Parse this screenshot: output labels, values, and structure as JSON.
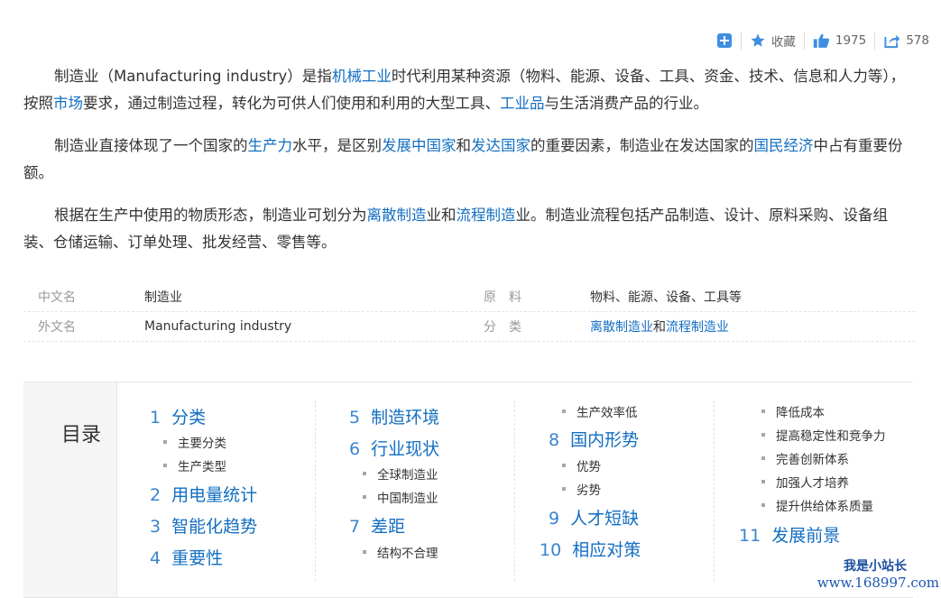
{
  "toolbar": {
    "collect_label": "收藏",
    "like_count": "1975",
    "share_count": "578"
  },
  "paragraphs": [
    [
      {
        "t": "制造业（Manufacturing industry）是指"
      },
      {
        "t": "机械工业",
        "link": true
      },
      {
        "t": "时代利用某种资源（物料、能源、设备、工具、资金、技术、信息和人力等），按照"
      },
      {
        "t": "市场",
        "link": true
      },
      {
        "t": "要求，通过制造过程，转化为可供人们使用和利用的大型工具、"
      },
      {
        "t": "工业品",
        "link": true
      },
      {
        "t": "与生活消费产品的行业。"
      }
    ],
    [
      {
        "t": "制造业直接体现了一个国家的"
      },
      {
        "t": "生产力",
        "link": true
      },
      {
        "t": "水平，是区别"
      },
      {
        "t": "发展中国家",
        "link": true
      },
      {
        "t": "和"
      },
      {
        "t": "发达国家",
        "link": true
      },
      {
        "t": "的重要因素，制造业在发达国家的"
      },
      {
        "t": "国民经济",
        "link": true
      },
      {
        "t": "中占有重要份额。"
      }
    ],
    [
      {
        "t": "根据在生产中使用的物质形态，制造业可划分为"
      },
      {
        "t": "离散制造",
        "link": true
      },
      {
        "t": "业和"
      },
      {
        "t": "流程制造",
        "link": true
      },
      {
        "t": "业。制造业流程包括产品制造、设计、原料采购、设备组装、仓储运输、订单处理、批发经营、零售等。"
      }
    ]
  ],
  "info": {
    "rows": [
      {
        "k1": "中文名",
        "v1": "制造业",
        "k2": "原　料",
        "v2": [
          {
            "t": "物料、能源、设备、工具等"
          }
        ]
      },
      {
        "k1": "外文名",
        "v1": "Manufacturing industry",
        "k2": "分　类",
        "v2": [
          {
            "t": "离散制造业",
            "link": true
          },
          {
            "t": "和"
          },
          {
            "t": "流程制造业",
            "link": true
          }
        ]
      }
    ]
  },
  "catalog": {
    "title": "目录",
    "columns": [
      [
        {
          "level": 1,
          "index": "1",
          "text": "分类"
        },
        {
          "level": 2,
          "text": "主要分类"
        },
        {
          "level": 2,
          "text": "生产类型"
        },
        {
          "level": 1,
          "index": "2",
          "text": "用电量统计"
        },
        {
          "level": 1,
          "index": "3",
          "text": "智能化趋势"
        },
        {
          "level": 1,
          "index": "4",
          "text": "重要性"
        }
      ],
      [
        {
          "level": 1,
          "index": "5",
          "text": "制造环境"
        },
        {
          "level": 1,
          "index": "6",
          "text": "行业现状"
        },
        {
          "level": 2,
          "text": "全球制造业"
        },
        {
          "level": 2,
          "text": "中国制造业"
        },
        {
          "level": 1,
          "index": "7",
          "text": "差距"
        },
        {
          "level": 2,
          "text": "结构不合理"
        }
      ],
      [
        {
          "level": 2,
          "text": "生产效率低"
        },
        {
          "level": 1,
          "index": "8",
          "text": "国内形势"
        },
        {
          "level": 2,
          "text": "优势"
        },
        {
          "level": 2,
          "text": "劣势"
        },
        {
          "level": 1,
          "index": "9",
          "text": "人才短缺"
        },
        {
          "level": 1,
          "index": "10",
          "text": "相应对策"
        }
      ],
      [
        {
          "level": 2,
          "text": "降低成本"
        },
        {
          "level": 2,
          "text": "提高稳定性和竞争力"
        },
        {
          "level": 2,
          "text": "完善创新体系"
        },
        {
          "level": 2,
          "text": "加强人才培养"
        },
        {
          "level": 2,
          "text": "提升供给体系质量"
        },
        {
          "level": 1,
          "index": "11",
          "text": "发展前景"
        }
      ]
    ]
  },
  "watermark": {
    "line1": "我是小站长",
    "line2": "www.168997.com"
  },
  "colors": {
    "link": "#136ec2",
    "text": "#333333",
    "muted": "#999999"
  }
}
